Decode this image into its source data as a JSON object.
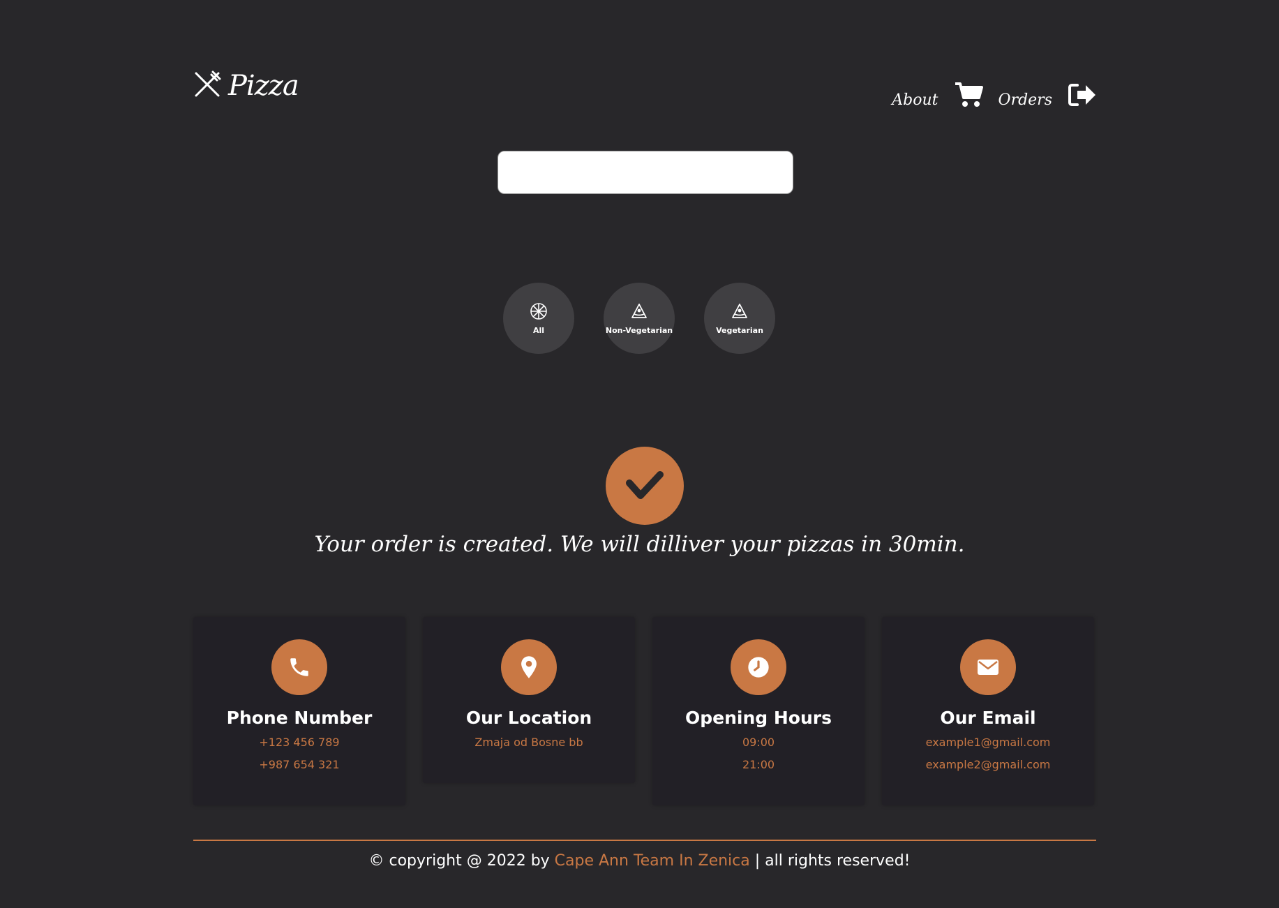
{
  "header": {
    "logo_text": "Pizza",
    "nav": [
      {
        "label": "About",
        "icon": "cart-icon"
      },
      {
        "label": "Orders",
        "icon": "logout-icon"
      }
    ]
  },
  "search": {
    "placeholder": "",
    "value": ""
  },
  "categories": [
    {
      "label": "All",
      "icon": "pizza-icon"
    },
    {
      "label": "Non-Vegetarian",
      "icon": "pizza-slice-icon"
    },
    {
      "label": "Vegetarian",
      "icon": "pizza-slice-icon"
    }
  ],
  "success": {
    "icon": "check-icon",
    "message": "Your order is created. We will dilliver your pizzas in 30min."
  },
  "cards": [
    {
      "title": "Phone Number",
      "icon": "phone-icon",
      "lines": [
        "+123 456 789",
        "+987 654 321"
      ]
    },
    {
      "title": "Our Location",
      "icon": "location-pin-icon",
      "lines": [
        "Zmaja od Bosne bb"
      ]
    },
    {
      "title": "Opening Hours",
      "icon": "clock-icon",
      "lines": [
        "09:00",
        "21:00"
      ]
    },
    {
      "title": "Our Email",
      "icon": "mail-icon",
      "lines": [
        "example1@gmail.com",
        "example2@gmail.com"
      ]
    }
  ],
  "footer": {
    "prefix": "© copyright @ 2022 by ",
    "team": "Cape Ann Team In Zenica",
    "suffix": " | all rights reserved!"
  },
  "colors": {
    "background": "#28272a",
    "accent": "#c97844",
    "card": "#222026",
    "category": "#403f42"
  }
}
